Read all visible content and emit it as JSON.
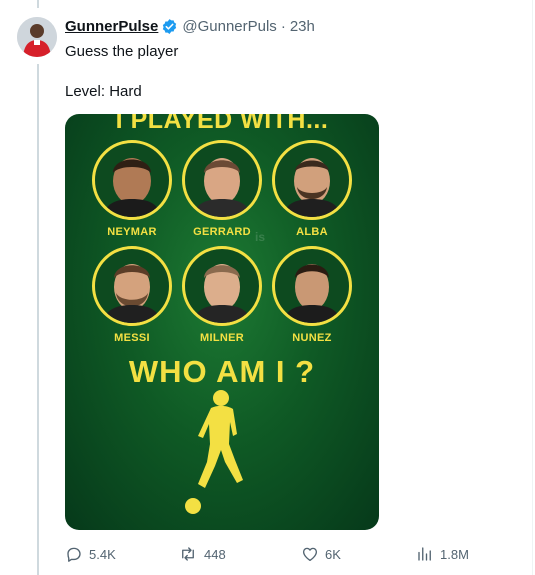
{
  "tweet": {
    "author_name": "GunnerPulse",
    "handle": "@GunnerPuls",
    "separator": "·",
    "time": "23h",
    "text_line1": "Guess the player",
    "text_line2": "Level: Hard"
  },
  "media": {
    "banner": "I PLAYED WITH...",
    "watermark": "is",
    "question": "WHO AM I ?",
    "players": [
      {
        "name": "NEYMAR"
      },
      {
        "name": "GERRARD"
      },
      {
        "name": "ALBA"
      },
      {
        "name": "MESSI"
      },
      {
        "name": "MILNER"
      },
      {
        "name": "NUNEZ"
      }
    ]
  },
  "actions": {
    "replies": "5.4K",
    "reposts": "448",
    "likes": "6K",
    "views": "1.8M"
  },
  "colors": {
    "accent_yellow": "#f3e043",
    "card_green": "#0f5a25",
    "verified_blue": "#1d9bf0",
    "muted_text": "#536471"
  }
}
